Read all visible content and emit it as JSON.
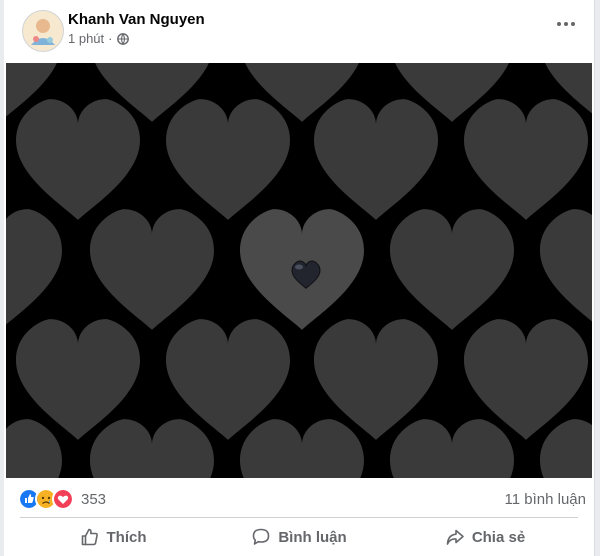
{
  "post": {
    "author": "Khanh Van Nguyen",
    "time": "1 phút",
    "privacy_icon": "globe-icon",
    "menu_icon": "more-horizontal-icon"
  },
  "media": {
    "description_icons": [
      "heart-pattern",
      "black-heart-emoji-icon"
    ],
    "background_color": "#000000",
    "heart_color": "#3a3a3a"
  },
  "engagement": {
    "reaction_icons": [
      "like-reaction-icon",
      "sad-reaction-icon",
      "love-reaction-icon"
    ],
    "reaction_count": "353",
    "comments": "11 bình luận"
  },
  "actions": {
    "like": "Thích",
    "comment": "Bình luận",
    "share": "Chia sẻ"
  },
  "colors": {
    "text_secondary": "#65676b",
    "like_blue": "#1877f2",
    "love_red": "#f33e58",
    "sad_yellow": "#f7b125"
  }
}
